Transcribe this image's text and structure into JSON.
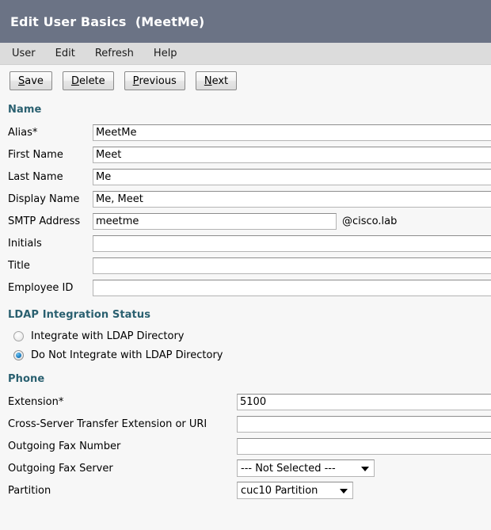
{
  "window": {
    "title": "Edit User Basics  (MeetMe)"
  },
  "menubar": {
    "items": [
      {
        "label": "User"
      },
      {
        "label": "Edit"
      },
      {
        "label": "Refresh"
      },
      {
        "label": "Help"
      }
    ]
  },
  "toolbar": {
    "buttons": [
      {
        "label": "Save",
        "mnemonic": "S",
        "rest": "ave"
      },
      {
        "label": "Delete",
        "mnemonic": "D",
        "rest": "elete"
      },
      {
        "label": "Previous",
        "mnemonic": "P",
        "rest": "revious"
      },
      {
        "label": "Next",
        "mnemonic": "N",
        "rest": "ext"
      }
    ]
  },
  "sections": {
    "name": {
      "heading": "Name",
      "fields": [
        {
          "label": "Alias*",
          "value": "MeetMe"
        },
        {
          "label": "First Name",
          "value": "Meet"
        },
        {
          "label": "Last Name",
          "value": "Me"
        },
        {
          "label": "Display Name",
          "value": "Me, Meet"
        },
        {
          "label": "SMTP Address",
          "value": "meetme",
          "suffix": "@cisco.lab"
        },
        {
          "label": "Initials",
          "value": ""
        },
        {
          "label": "Title",
          "value": ""
        },
        {
          "label": "Employee ID",
          "value": ""
        }
      ]
    },
    "ldap": {
      "heading": "LDAP Integration Status",
      "options": [
        {
          "label": "Integrate with LDAP Directory",
          "selected": false
        },
        {
          "label": "Do Not Integrate with LDAP Directory",
          "selected": true
        }
      ]
    },
    "phone": {
      "heading": "Phone",
      "fields": [
        {
          "label": "Extension*",
          "value": "5100",
          "type": "text"
        },
        {
          "label": "Cross-Server Transfer Extension or URI",
          "value": "",
          "type": "text"
        },
        {
          "label": "Outgoing Fax Number",
          "value": "",
          "type": "text"
        },
        {
          "label": "Outgoing Fax Server",
          "value": "--- Not Selected ---",
          "type": "select"
        },
        {
          "label": "Partition",
          "value": "cuc10 Partition",
          "type": "select"
        }
      ]
    }
  },
  "colors": {
    "titlebar_bg": "#6b7385",
    "menubar_bg": "#dcdcdc",
    "form_bg": "#f7f7f7",
    "section_heading": "#2a6070",
    "radio_selected": "#1d7fc4"
  }
}
